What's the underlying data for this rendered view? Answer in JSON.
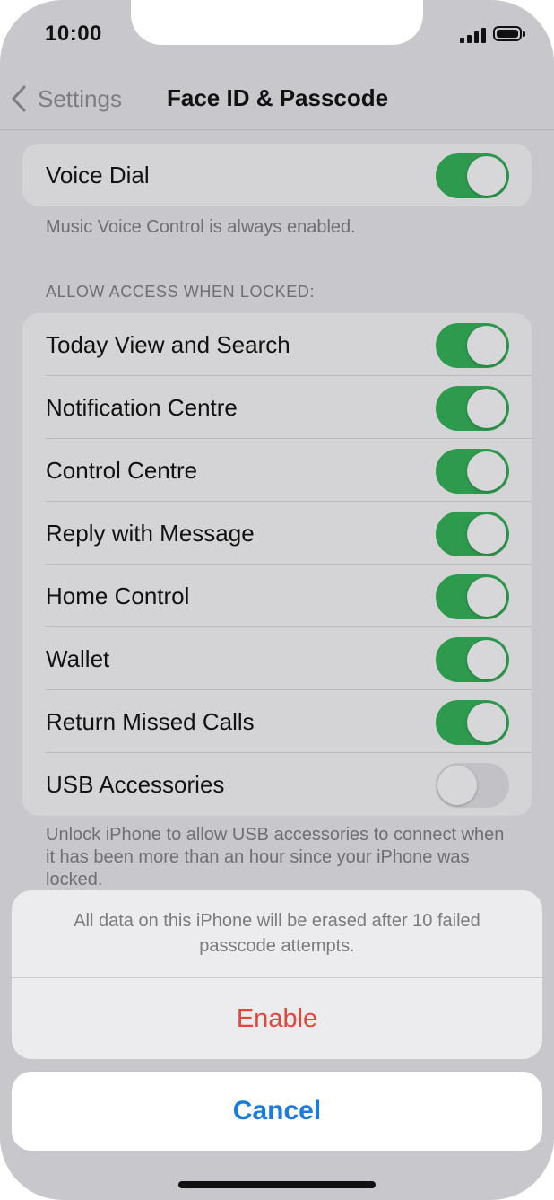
{
  "status_bar": {
    "time": "10:00"
  },
  "navigation": {
    "back_label": "Settings",
    "title": "Face ID & Passcode"
  },
  "voice_dial": {
    "label": "Voice Dial",
    "enabled": true,
    "note": "Music Voice Control is always enabled."
  },
  "locked_access": {
    "header": "ALLOW ACCESS WHEN LOCKED:",
    "items": [
      {
        "label": "Today View and Search",
        "enabled": true
      },
      {
        "label": "Notification Centre",
        "enabled": true
      },
      {
        "label": "Control Centre",
        "enabled": true
      },
      {
        "label": "Reply with Message",
        "enabled": true
      },
      {
        "label": "Home Control",
        "enabled": true
      },
      {
        "label": "Wallet",
        "enabled": true
      },
      {
        "label": "Return Missed Calls",
        "enabled": true
      },
      {
        "label": "USB Accessories",
        "enabled": false
      }
    ],
    "footer": "Unlock iPhone to allow USB accessories to connect when it has been more than an hour since your iPhone was locked."
  },
  "action_sheet": {
    "message": "All data on this iPhone will be erased after 10 failed passcode attempts.",
    "enable_label": "Enable",
    "cancel_label": "Cancel"
  },
  "colors": {
    "toggle_on": "#2d9a4e",
    "destructive": "#e2463b",
    "accent": "#1a7be0"
  }
}
